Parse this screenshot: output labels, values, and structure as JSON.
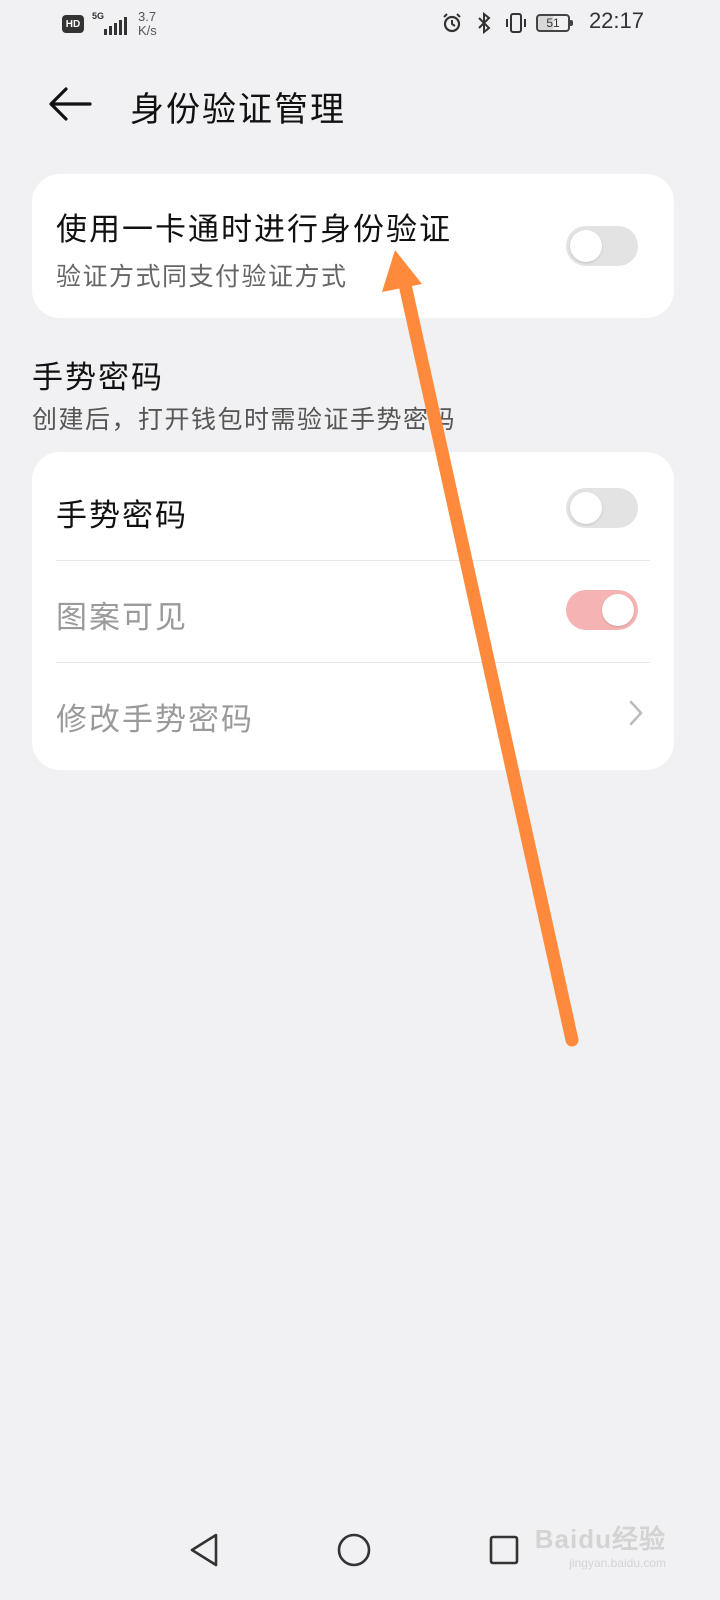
{
  "status_bar": {
    "hd_label": "HD",
    "network_label": "5G",
    "speed_value": "3.7",
    "speed_unit": "K/s",
    "battery_level": "51",
    "time": "22:17"
  },
  "header": {
    "title": "身份验证管理",
    "back_icon": "arrow-left-icon"
  },
  "card_card": {
    "title": "使用一卡通时进行身份验证",
    "subtitle": "验证方式同支付验证方式",
    "toggle_on": false
  },
  "gesture_section": {
    "title": "手势密码",
    "subtitle": "创建后，打开钱包时需验证手势密码",
    "items": [
      {
        "label": "手势密码",
        "control": "toggle",
        "toggle_on": false,
        "dimmed": false
      },
      {
        "label": "图案可见",
        "control": "toggle",
        "toggle_on": true,
        "dimmed": true
      },
      {
        "label": "修改手势密码",
        "control": "chevron",
        "dimmed": true
      }
    ]
  },
  "annotation": {
    "color": "#ff8a3c"
  },
  "nav_bar": {
    "back_icon": "triangle-back-icon",
    "home_icon": "circle-home-icon",
    "recents_icon": "square-recents-icon"
  },
  "watermark": {
    "brand": "Baidu经验",
    "url": "jingyan.baidu.com"
  },
  "colors": {
    "background": "#f1f1f3",
    "toggle_on": "#f5b3b3",
    "toggle_off": "#e3e3e3"
  }
}
